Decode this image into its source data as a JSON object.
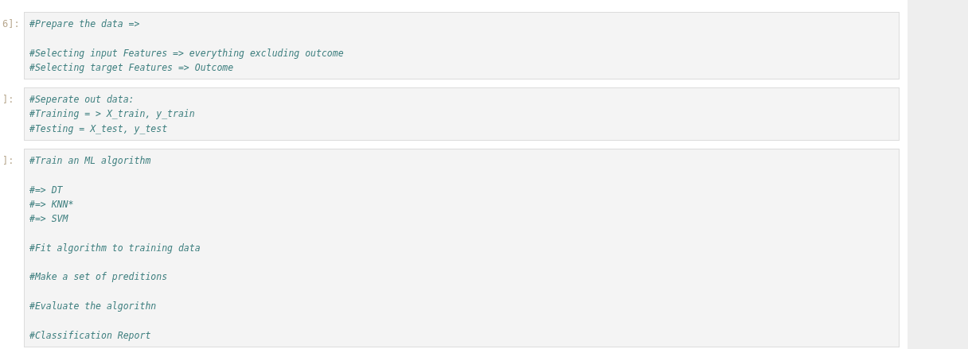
{
  "cells": [
    {
      "prompt": "6]:",
      "source": "#Prepare the data =>\n\n#Selecting input Features => everything excluding outcome\n#Selecting target Features => Outcome"
    },
    {
      "prompt": "]:",
      "source": "#Seperate out data:\n#Training = > X_train, y_train\n#Testing = X_test, y_test"
    },
    {
      "prompt": "]:",
      "source": "#Train an ML algorithm\n\n#=> DT\n#=> KNN*\n#=> SVM\n\n#Fit algorithm to training data\n\n#Make a set of preditions\n\n#Evaluate the algorithn\n\n#Classification Report"
    }
  ]
}
